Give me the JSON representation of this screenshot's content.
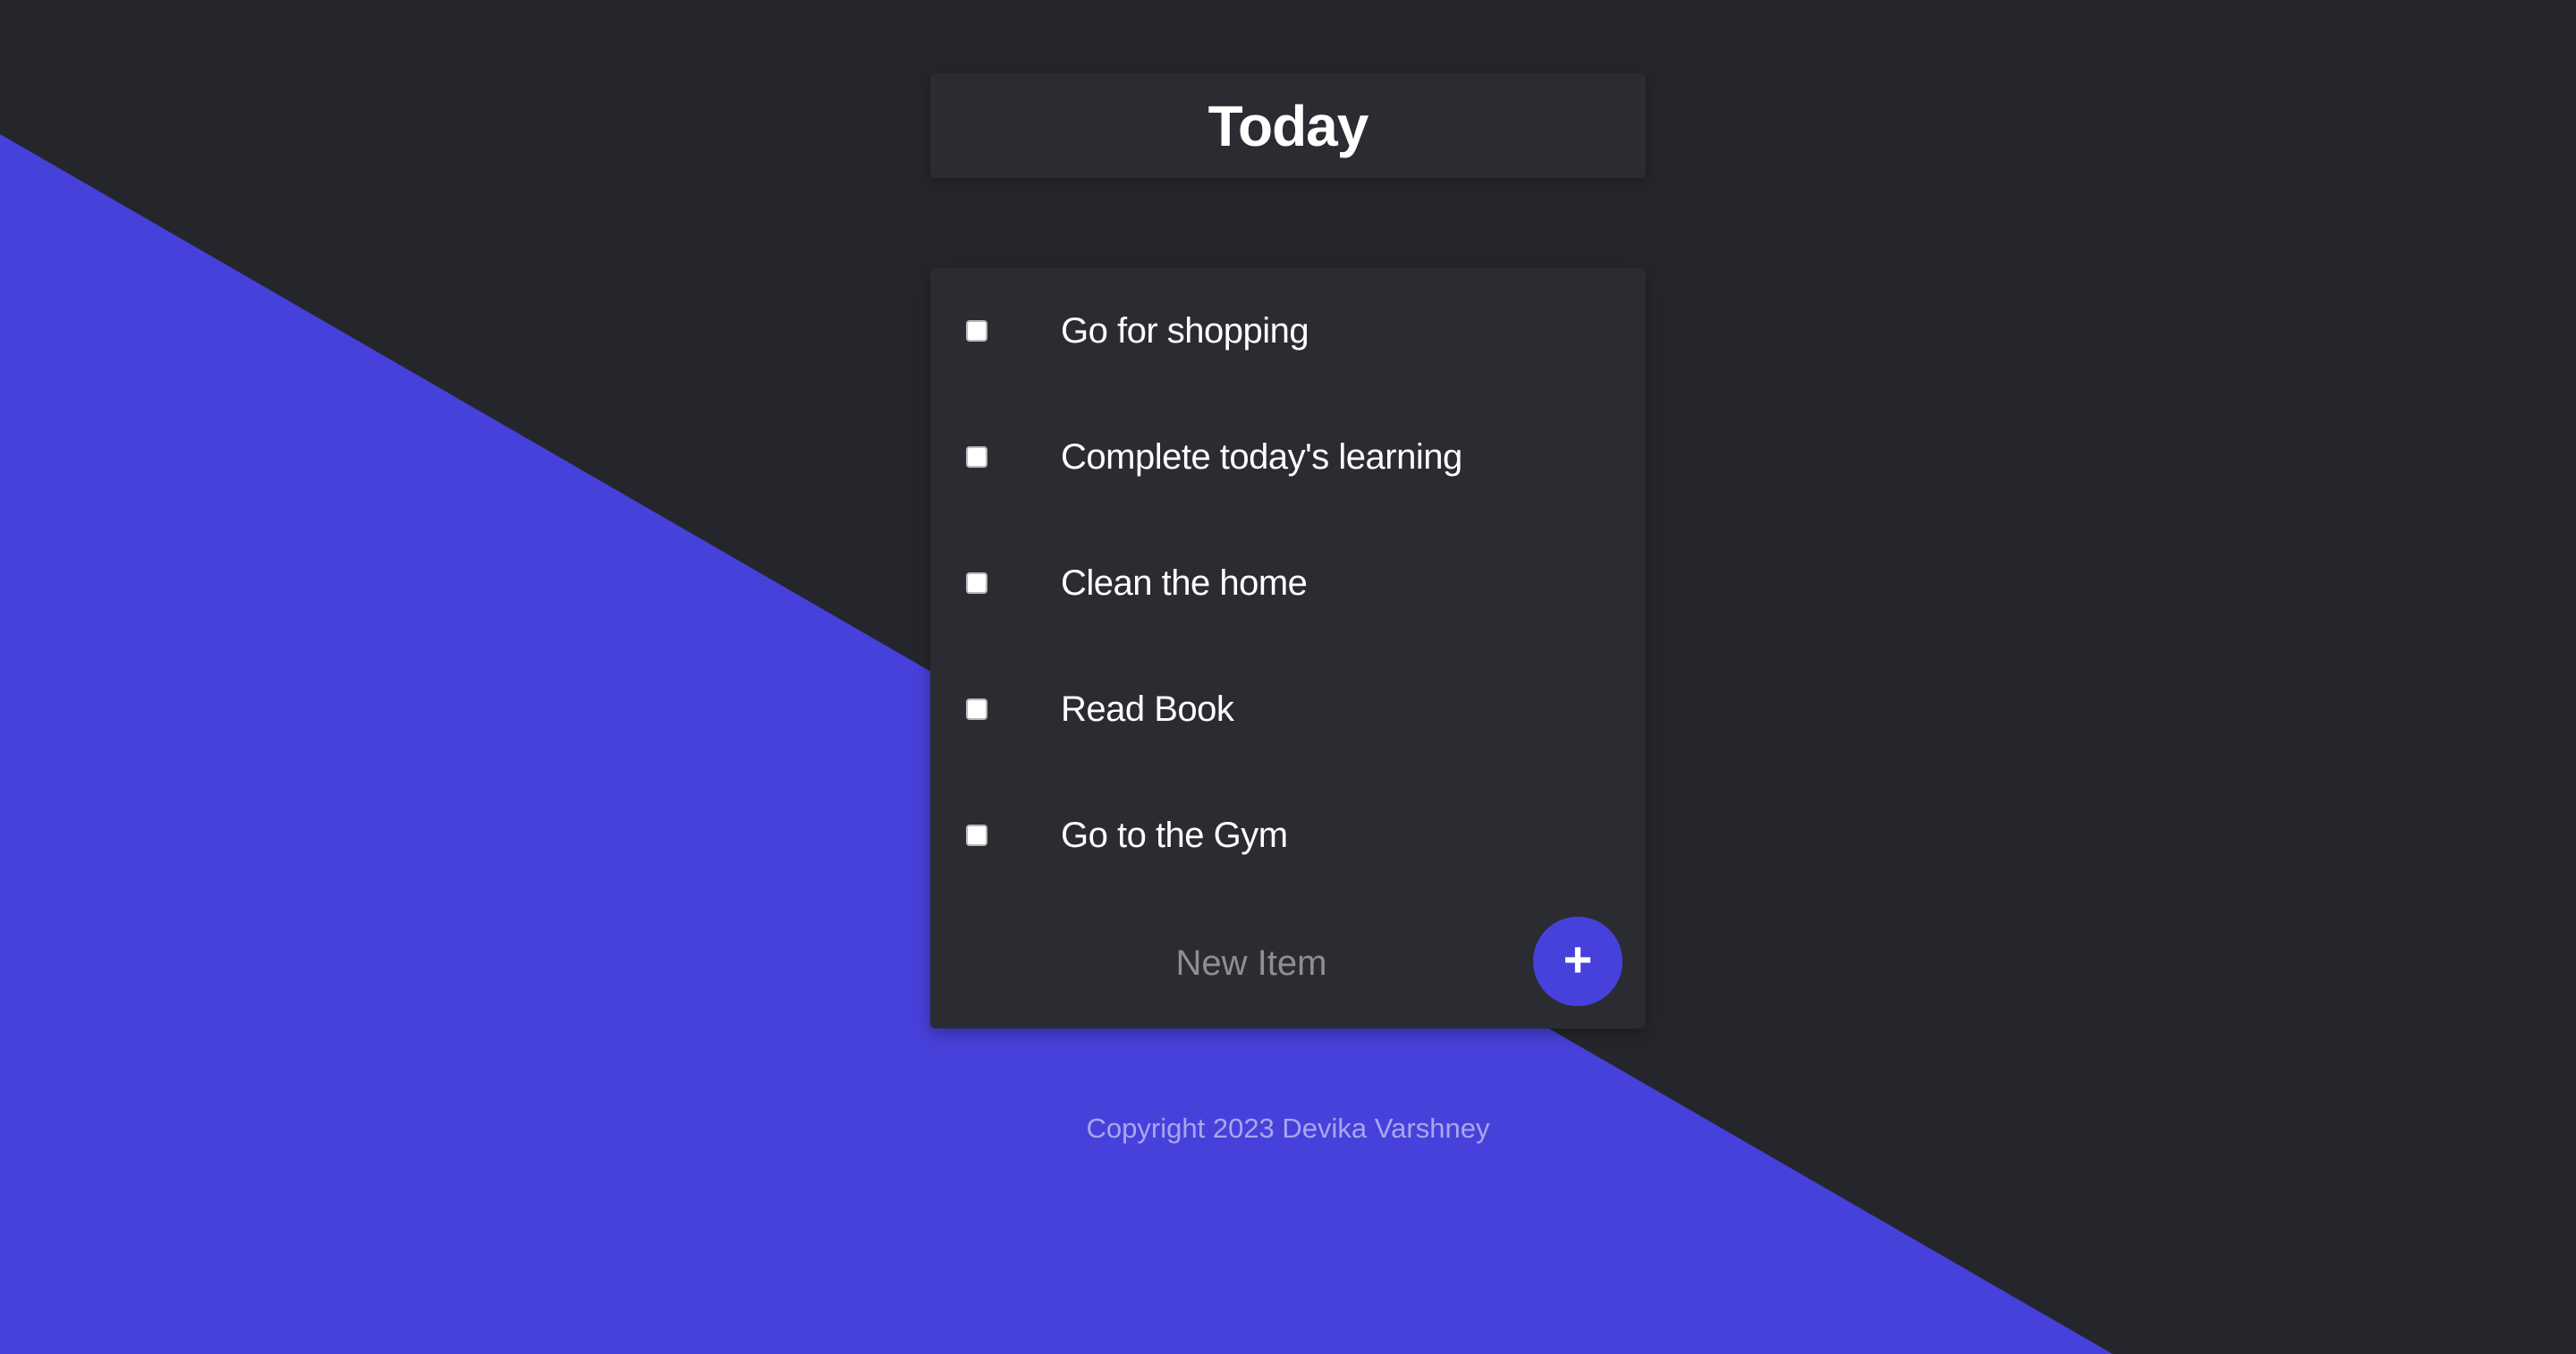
{
  "colors": {
    "background": "#25262b",
    "accent": "#4741db",
    "card": "#2b2c31",
    "footer_text": "#a9a6ee"
  },
  "heading": {
    "title": "Today"
  },
  "items": [
    {
      "label": "Go for shopping",
      "checked": false
    },
    {
      "label": "Complete today's learning",
      "checked": false
    },
    {
      "label": "Clean the home",
      "checked": false
    },
    {
      "label": "Read Book",
      "checked": false
    },
    {
      "label": "Go to the Gym",
      "checked": false
    }
  ],
  "new_item": {
    "placeholder": "New Item",
    "add_button_icon": "plus-icon",
    "add_button_symbol": "+"
  },
  "footer": {
    "text": "Copyright 2023 Devika Varshney"
  }
}
